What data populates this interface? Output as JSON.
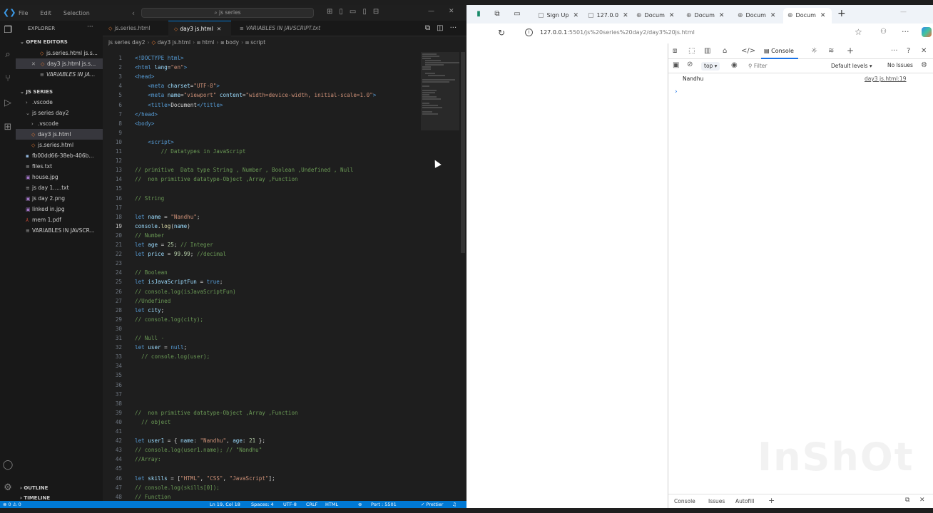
{
  "vscode": {
    "menu": [
      "File",
      "Edit",
      "Selection"
    ],
    "search": "js series",
    "explorer": {
      "title": "EXPLORER",
      "open_editors": "OPEN EDITORS",
      "open_items": [
        "js.series.html js.s...",
        "day3 js.html js.s...",
        "VARIABLES IN JA..."
      ],
      "folder": "JS SERIES",
      "tree": [
        ".vscode",
        "js series day2",
        ".vscode",
        "day3 js.html",
        "js.series.html",
        "fb00dd66-38eb-406b...",
        "files.txt",
        "house.jpg",
        "js day 1.....txt",
        "js day 2.png",
        "linked in.jpg",
        "mem 1.pdf",
        "VARIABLES IN JAVSCR..."
      ],
      "outline": "OUTLINE",
      "timeline": "TIMELINE"
    },
    "tabs": [
      "js.series.html",
      "day3 js.html",
      "VARIABLES IN JAVSCRIPT.txt"
    ],
    "breadcrumb": [
      "js series day2",
      "day3 js.html",
      "html",
      "body",
      "script"
    ],
    "status": {
      "left": "⊗ 0 ⚠ 0",
      "position": "Ln 19, Col 18",
      "spaces": "Spaces: 4",
      "encoding": "UTF-8",
      "eol": "CRLF",
      "lang": "HTML",
      "port": "Port : 5501",
      "prettier": "✓ Prettier"
    }
  },
  "code": [
    {
      "n": "1",
      "s": [
        [
          "t-tag",
          "<!DOCTYPE html>"
        ]
      ]
    },
    {
      "n": "2",
      "s": [
        [
          "t-tag",
          "<html "
        ],
        [
          "t-attr",
          "lang"
        ],
        [
          "t-pl",
          "="
        ],
        [
          "t-str",
          "\"en\""
        ],
        [
          "t-tag",
          ">"
        ]
      ]
    },
    {
      "n": "3",
      "s": [
        [
          "t-tag",
          "<head>"
        ]
      ]
    },
    {
      "n": "4",
      "s": [
        [
          "t-pl",
          "    "
        ],
        [
          "t-tag",
          "<meta "
        ],
        [
          "t-attr",
          "charset"
        ],
        [
          "t-pl",
          "="
        ],
        [
          "t-str",
          "\"UTF-8\""
        ],
        [
          "t-tag",
          ">"
        ]
      ]
    },
    {
      "n": "5",
      "s": [
        [
          "t-pl",
          "    "
        ],
        [
          "t-tag",
          "<meta "
        ],
        [
          "t-attr",
          "name"
        ],
        [
          "t-pl",
          "="
        ],
        [
          "t-str",
          "\"viewport\""
        ],
        [
          "t-attr",
          " content"
        ],
        [
          "t-pl",
          "="
        ],
        [
          "t-str",
          "\"width=device-width, initial-scale=1.0\""
        ],
        [
          "t-tag",
          ">"
        ]
      ]
    },
    {
      "n": "6",
      "s": [
        [
          "t-pl",
          "    "
        ],
        [
          "t-tag",
          "<title>"
        ],
        [
          "t-pl",
          "Document"
        ],
        [
          "t-tag",
          "</title>"
        ]
      ]
    },
    {
      "n": "7",
      "s": [
        [
          "t-tag",
          "</head>"
        ]
      ]
    },
    {
      "n": "8",
      "s": [
        [
          "t-tag",
          "<body>"
        ]
      ]
    },
    {
      "n": "9",
      "s": []
    },
    {
      "n": "10",
      "s": [
        [
          "t-pl",
          "    "
        ],
        [
          "t-tag",
          "<script>"
        ]
      ]
    },
    {
      "n": "11",
      "s": [
        [
          "t-pl",
          "        "
        ],
        [
          "t-com",
          "// Datatypes in JavaScript"
        ]
      ]
    },
    {
      "n": "12",
      "s": []
    },
    {
      "n": "13",
      "s": [
        [
          "t-com",
          "// primitive  Data type String , Number , Boolean ,Undefined , Null"
        ]
      ]
    },
    {
      "n": "14",
      "s": [
        [
          "t-com",
          "//  non primitive datatype-Object ,Array ,Function"
        ]
      ]
    },
    {
      "n": "15",
      "s": []
    },
    {
      "n": "16",
      "s": [
        [
          "t-com",
          "// String"
        ]
      ]
    },
    {
      "n": "17",
      "s": []
    },
    {
      "n": "18",
      "s": [
        [
          "t-kw",
          "let "
        ],
        [
          "t-var",
          "name"
        ],
        [
          "t-pl",
          " = "
        ],
        [
          "t-str",
          "\"Nandhu\""
        ],
        [
          "t-pl",
          ";"
        ]
      ]
    },
    {
      "n": "19",
      "s": [
        [
          "t-var",
          "console"
        ],
        [
          "t-pl",
          "."
        ],
        [
          "t-fn",
          "log"
        ],
        [
          "t-pl",
          "("
        ],
        [
          "t-var",
          "name"
        ],
        [
          "t-pl",
          ")"
        ]
      ],
      "cur": true
    },
    {
      "n": "20",
      "s": [
        [
          "t-com",
          "// Number"
        ]
      ]
    },
    {
      "n": "21",
      "s": [
        [
          "t-kw",
          "let "
        ],
        [
          "t-var",
          "age"
        ],
        [
          "t-pl",
          " = "
        ],
        [
          "t-num",
          "25"
        ],
        [
          "t-pl",
          "; "
        ],
        [
          "t-com",
          "// Integer"
        ]
      ]
    },
    {
      "n": "22",
      "s": [
        [
          "t-kw",
          "let "
        ],
        [
          "t-var",
          "price"
        ],
        [
          "t-pl",
          " = "
        ],
        [
          "t-num",
          "99.99"
        ],
        [
          "t-pl",
          "; "
        ],
        [
          "t-com",
          "//decimal"
        ]
      ]
    },
    {
      "n": "23",
      "s": []
    },
    {
      "n": "24",
      "s": [
        [
          "t-com",
          "// Boolean"
        ]
      ]
    },
    {
      "n": "25",
      "s": [
        [
          "t-kw",
          "let "
        ],
        [
          "t-var",
          "isJavaScriptFun"
        ],
        [
          "t-pl",
          " = "
        ],
        [
          "t-kw",
          "true"
        ],
        [
          "t-pl",
          ";"
        ]
      ]
    },
    {
      "n": "26",
      "s": [
        [
          "t-com",
          "// console.log(isJavaScriptFun)"
        ]
      ]
    },
    {
      "n": "27",
      "s": [
        [
          "t-com",
          "//Undefined"
        ]
      ]
    },
    {
      "n": "28",
      "s": [
        [
          "t-kw",
          "let "
        ],
        [
          "t-var",
          "city"
        ],
        [
          "t-pl",
          ";"
        ]
      ]
    },
    {
      "n": "29",
      "s": [
        [
          "t-com",
          "// console.log(city);"
        ]
      ]
    },
    {
      "n": "30",
      "s": []
    },
    {
      "n": "31",
      "s": [
        [
          "t-com",
          "// Null -"
        ]
      ]
    },
    {
      "n": "32",
      "s": [
        [
          "t-kw",
          "let "
        ],
        [
          "t-var",
          "user"
        ],
        [
          "t-pl",
          " = "
        ],
        [
          "t-kw",
          "null"
        ],
        [
          "t-pl",
          ";"
        ]
      ]
    },
    {
      "n": "33",
      "s": [
        [
          "t-pl",
          "  "
        ],
        [
          "t-com",
          "// console.log(user);"
        ]
      ]
    },
    {
      "n": "34",
      "s": []
    },
    {
      "n": "35",
      "s": []
    },
    {
      "n": "36",
      "s": []
    },
    {
      "n": "37",
      "s": []
    },
    {
      "n": "38",
      "s": []
    },
    {
      "n": "39",
      "s": [
        [
          "t-com",
          "//  non primitive datatype-Object ,Array ,Function"
        ]
      ]
    },
    {
      "n": "40",
      "s": [
        [
          "t-pl",
          "  "
        ],
        [
          "t-com",
          "// object"
        ]
      ]
    },
    {
      "n": "41",
      "s": []
    },
    {
      "n": "42",
      "s": [
        [
          "t-kw",
          "let "
        ],
        [
          "t-var",
          "user1"
        ],
        [
          "t-pl",
          " = { "
        ],
        [
          "t-var",
          "name"
        ],
        [
          "t-pl",
          ": "
        ],
        [
          "t-str",
          "\"Nandhu\""
        ],
        [
          "t-pl",
          ", "
        ],
        [
          "t-var",
          "age"
        ],
        [
          "t-pl",
          ": "
        ],
        [
          "t-num",
          "21"
        ],
        [
          "t-pl",
          " };"
        ]
      ]
    },
    {
      "n": "43",
      "s": [
        [
          "t-com",
          "// console.log(user1.name); // \"Nandhu\""
        ]
      ]
    },
    {
      "n": "44",
      "s": [
        [
          "t-com",
          "//Array:"
        ]
      ]
    },
    {
      "n": "45",
      "s": []
    },
    {
      "n": "46",
      "s": [
        [
          "t-kw",
          "let "
        ],
        [
          "t-var",
          "skills"
        ],
        [
          "t-pl",
          " = ["
        ],
        [
          "t-str",
          "\"HTML\""
        ],
        [
          "t-pl",
          ", "
        ],
        [
          "t-str",
          "\"CSS\""
        ],
        [
          "t-pl",
          ", "
        ],
        [
          "t-str",
          "\"JavaScript\""
        ],
        [
          "t-pl",
          "];"
        ]
      ]
    },
    {
      "n": "47",
      "s": [
        [
          "t-com",
          "// console.log(skills[0]);"
        ]
      ]
    },
    {
      "n": "48",
      "s": [
        [
          "t-com",
          "// Function"
        ]
      ]
    }
  ],
  "browser": {
    "tabs": [
      "Sign Up",
      "127.0.0",
      "Docum",
      "Docum",
      "Docum",
      "Docum"
    ],
    "url_host": "127.0.0.1",
    "url_path": ":5501/js%20series%20day2/day3%20js.html",
    "devtools": {
      "console_tab": "Console",
      "context": "top",
      "filter_placeholder": "Filter",
      "levels": "Default levels",
      "issues": "No Issues",
      "log_message": "Nandhu",
      "log_source": "day3 js.html:19",
      "drawer": [
        "Console",
        "Issues",
        "Autofill"
      ]
    }
  },
  "watermark": "InShOt"
}
